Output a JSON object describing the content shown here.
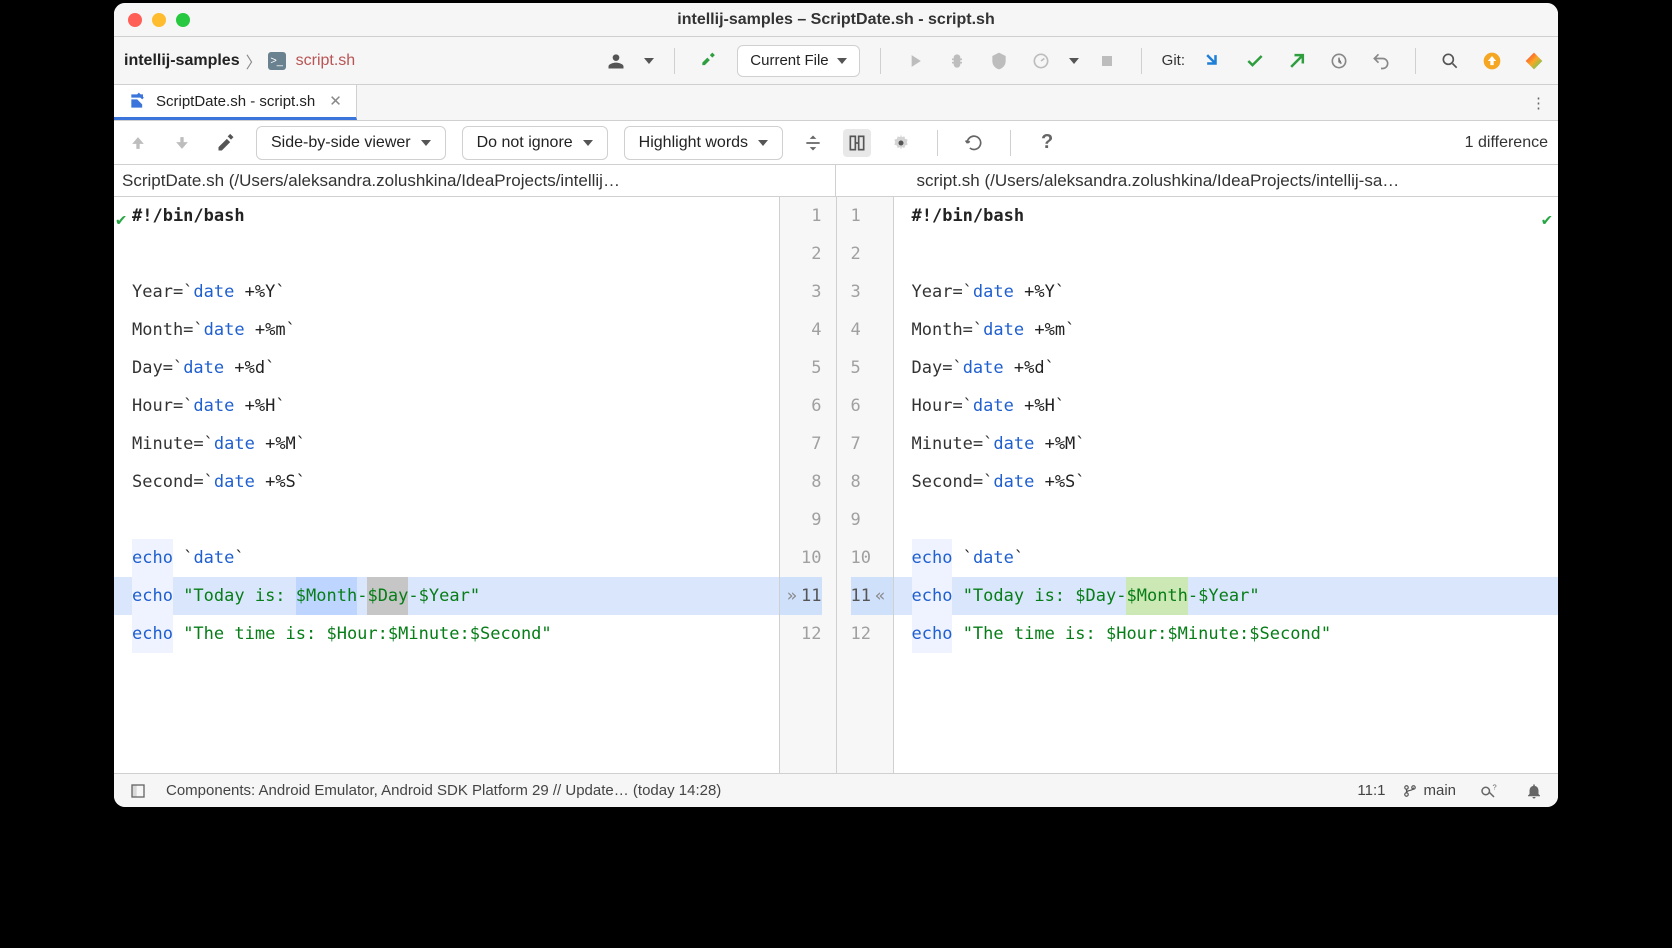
{
  "title": "intellij-samples – ScriptDate.sh - script.sh",
  "crumbs": {
    "project": "intellij-samples",
    "file": "script.sh"
  },
  "run_config": "Current File",
  "git_label": "Git:",
  "tab": {
    "label": "ScriptDate.sh - script.sh"
  },
  "difftb": {
    "viewer_mode": "Side-by-side viewer",
    "ignore_mode": "Do not ignore",
    "highlight_mode": "Highlight words",
    "difference_summary": "1 difference"
  },
  "paths": {
    "left": "ScriptDate.sh (/Users/aleksandra.zolushkina/IdeaProjects/intellij…",
    "right": "script.sh (/Users/aleksandra.zolushkina/IdeaProjects/intellij-sa…"
  },
  "line_numbers": [
    "1",
    "2",
    "3",
    "4",
    "5",
    "6",
    "7",
    "8",
    "9",
    "10",
    "11",
    "12"
  ],
  "left_code": {
    "l1": "#!/bin/bash",
    "l3_a": "Year=`",
    "l3_cmd": "date",
    "l3_b": " +%Y",
    "l3_c": "`",
    "l4_a": "Month=`",
    "l4_cmd": "date",
    "l4_b": " +%m",
    "l4_c": "`",
    "l5_a": "Day=`",
    "l5_cmd": "date",
    "l5_b": " +%d",
    "l5_c": "`",
    "l6_a": "Hour=`",
    "l6_cmd": "date",
    "l6_b": " +%H",
    "l6_c": "`",
    "l7_a": "Minute=`",
    "l7_cmd": "date",
    "l7_b": " +%M",
    "l7_c": "`",
    "l8_a": "Second=`",
    "l8_cmd": "date",
    "l8_b": " +%S",
    "l8_c": "`",
    "l10_a": "echo",
    "l10_b": " `",
    "l10_cmd": "date",
    "l10_c": "`",
    "l11_a": "echo",
    "l11_b": " \"Today is: ",
    "l11_m": "$Month",
    "l11_h": "-",
    "l11_d": "$Day",
    "l11_h2": "-$Year\"",
    "l12_a": "echo",
    "l12_b": " \"The time is: $Hour:$Minute:$Second\""
  },
  "right_code": {
    "l1": "#!/bin/bash",
    "l3_a": "Year=`",
    "l3_cmd": "date",
    "l3_b": " +%Y",
    "l3_c": "`",
    "l4_a": "Month=`",
    "l4_cmd": "date",
    "l4_b": " +%m",
    "l4_c": "`",
    "l5_a": "Day=`",
    "l5_cmd": "date",
    "l5_b": " +%d",
    "l5_c": "`",
    "l6_a": "Hour=`",
    "l6_cmd": "date",
    "l6_b": " +%H",
    "l6_c": "`",
    "l7_a": "Minute=`",
    "l7_cmd": "date",
    "l7_b": " +%M",
    "l7_c": "`",
    "l8_a": "Second=`",
    "l8_cmd": "date",
    "l8_b": " +%S",
    "l8_c": "`",
    "l10_a": "echo",
    "l10_b": " `",
    "l10_cmd": "date",
    "l10_c": "`",
    "l11_a": "echo",
    "l11_b": " \"Today is: ",
    "l11_d": "$Day",
    "l11_h": "-",
    "l11_m": "$Month",
    "l11_h2": "-$Year\"",
    "l12_a": "echo",
    "l12_b": " \"The time is: $Hour:$Minute:$Second\""
  },
  "status": {
    "message": "Components: Android Emulator, Android SDK Platform 29 // Update… (today 14:28)",
    "linecol": "11:1",
    "branch": "main"
  }
}
